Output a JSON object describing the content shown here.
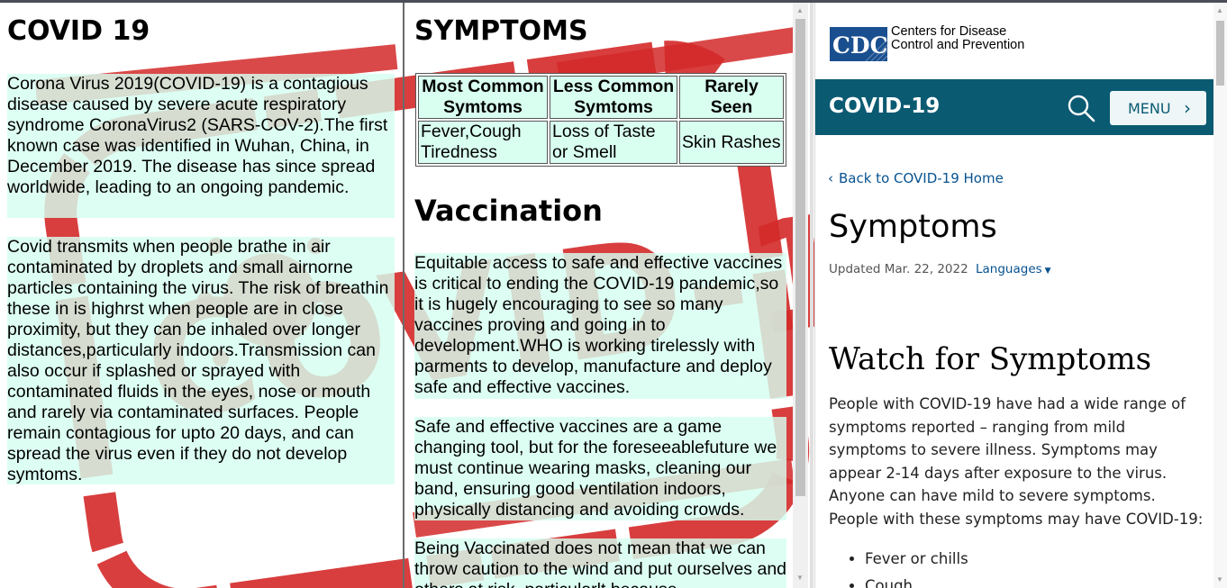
{
  "left_panel": {
    "title": "COVID 19",
    "paragraphs": [
      "Corona Virus 2019(COVID-19) is a contagious disease caused by severe acute respiratory syndrome CoronaVirus2 (SARS-COV-2).The first known case was identified in Wuhan, China, in December 2019. The disease has since spread worldwide, leading to an ongoing pandemic.",
      "Covid transmits when people brathe in air contaminated by droplets and small airnorne particles containing the virus. The risk of breathin these in is highrst when people are in close proximity, but they can be inhaled over longer distances,particularly indoors.Transmission can also occur if splashed or sprayed with contaminated fluids in the eyes, nose or mouth and rarely via contaminated surfaces. People remain contagious for upto 20 days, and can spread the virus even if they do not develop symtoms."
    ]
  },
  "middle_panel": {
    "title": "SYMPTOMS",
    "table": {
      "headers": [
        "Most Common Symtoms",
        "Less Common Symtoms",
        "Rarely Seen"
      ],
      "rows": [
        [
          "Fever,Cough Tiredness",
          "Loss of Taste or Smell",
          "Skin Rashes"
        ]
      ]
    },
    "vaccination_title": "Vaccination",
    "paragraphs": [
      "Equitable access to safe and effective vaccines is critical to ending the COVID-19 pandemic,so it is hugely encouraging to see so many vaccines proving and going in to development.WHO is working tirelessly with parments to develop, manufacture and deploy safe and effective vaccines.",
      "Safe and effective vaccines are a game changing tool, but for the foreseeablefuture we must continue wearing masks, cleaning our band, ensuring good ventilation indoors, physically distancing and avoiding crowds.",
      "Being Vaccinated does not mean that we can throw caution to the wind and put ourselves and others at risk, particularlt because"
    ]
  },
  "watermark": {
    "text": "COVID-19",
    "color": "#d42a2a"
  },
  "cdc_panel": {
    "logo_text": "CDC",
    "org_line1": "Centers for Disease",
    "org_line2": "Control and Prevention",
    "bar_title": "COVID-19",
    "menu_label": "MENU",
    "back_link": "Back to COVID-19 Home",
    "page_title": "Symptoms",
    "updated": "Updated Mar. 22, 2022",
    "languages": "Languages",
    "section_title": "Watch for Symptoms",
    "body": "People with COVID-19 have had a wide range of symptoms reported – ranging from mild symptoms to severe illness. Symptoms may appear 2-14 days after exposure to the virus. Anyone can have mild to severe symptoms. People with these symptoms may have COVID-19:",
    "list": [
      "Fever or chills",
      "Cough"
    ],
    "colors": {
      "bar": "#0a5a72",
      "link": "#075290",
      "logo": "#1a4f8f"
    }
  }
}
